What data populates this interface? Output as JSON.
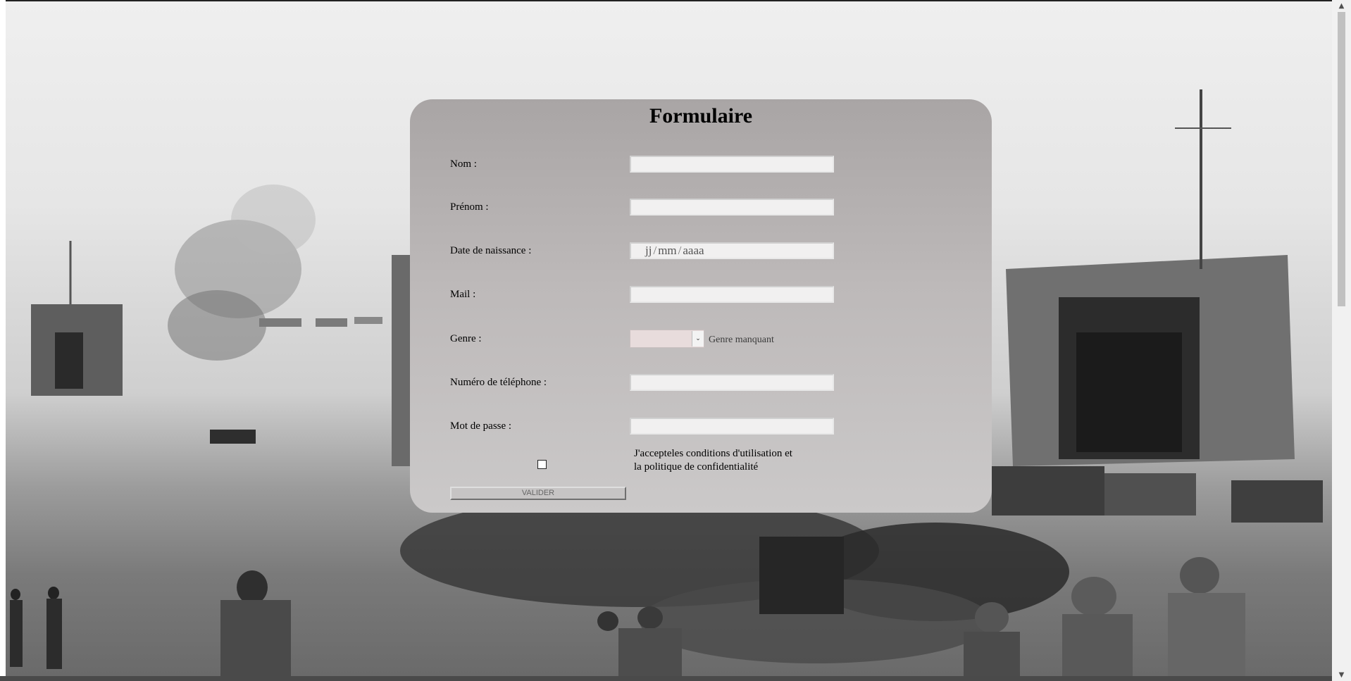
{
  "form": {
    "title": "Formulaire",
    "fields": {
      "nom": {
        "label": "Nom :",
        "value": ""
      },
      "prenom": {
        "label": "Prénom :",
        "value": ""
      },
      "naissance": {
        "label": "Date de naissance :",
        "day": "jj",
        "month": "mm",
        "year": "aaaa",
        "separator": "/"
      },
      "mail": {
        "label": "Mail :",
        "value": ""
      },
      "genre": {
        "label": "Genre :",
        "selected": "",
        "hint": "Genre manquant"
      },
      "telephone": {
        "label": "Numéro de téléphone :",
        "value": ""
      },
      "password": {
        "label": "Mot de passe :",
        "value": ""
      }
    },
    "terms": {
      "line1": "J'accepteles conditions d'utilisation et",
      "line2": "la politique de confidentialité",
      "checked": false
    },
    "submit_label": "VALIDER"
  },
  "colors": {
    "card_top": "#a9a5a5",
    "card_bottom": "#cbc9c9",
    "select_bg": "#e8dcdc"
  },
  "icons": {
    "select_arrow": "chevron-down-icon",
    "scroll_up": "arrow-up-icon",
    "scroll_down": "arrow-down-icon"
  }
}
